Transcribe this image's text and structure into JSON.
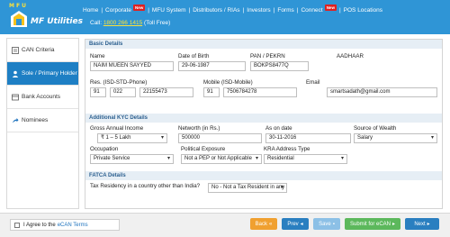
{
  "logo": {
    "letters": "MFU",
    "text": "MF Utilities"
  },
  "nav": {
    "items": [
      {
        "label": "Home",
        "badge": ""
      },
      {
        "label": "Corporate",
        "badge": "New"
      },
      {
        "label": "MFU System",
        "badge": ""
      },
      {
        "label": "Distributors / RIAs",
        "badge": ""
      },
      {
        "label": "Investors",
        "badge": ""
      },
      {
        "label": "Forms",
        "badge": ""
      },
      {
        "label": "Connect",
        "badge": "New"
      },
      {
        "label": "POS Locations",
        "badge": ""
      }
    ],
    "call_prefix": "Call: ",
    "phone": "1800 266 1415",
    "call_suffix": " (Toll Free)"
  },
  "sidebar": {
    "items": [
      {
        "label": "CAN Criteria",
        "icon": "checklist-icon"
      },
      {
        "label": "Sole / Primary Holder",
        "icon": "user-icon"
      },
      {
        "label": "Bank Accounts",
        "icon": "bank-icon"
      },
      {
        "label": "Nominees",
        "icon": "share-icon"
      }
    ]
  },
  "basic": {
    "heading": "Basic Details",
    "name_label": "Name",
    "name_value": "NAIM MUEEN SAYYED",
    "dob_label": "Date of Birth",
    "dob_value": "29-06-1987",
    "pan_label": "PAN / PEKRN",
    "pan_value": "BOKPS8477Q",
    "aadhaar_label": "AADHAAR",
    "aadhaar_value": "",
    "res_label": "Res. (ISD-STD-Phone)",
    "res_isd": "91",
    "res_std": "022",
    "res_phone": "22155473",
    "mobile_label": "Mobile (ISD-Mobile)",
    "mobile_isd": "91",
    "mobile_value": "7506784278",
    "email_label": "Email",
    "email_value": "smartsadath@gmail.com"
  },
  "kyc": {
    "heading": "Additional KYC Details",
    "income_label": "Gross Annual Income",
    "income_value": "₹ 1 – 5 Lakh",
    "networth_label": "Networth (in Rs.)",
    "networth_value": "500000",
    "ason_label": "As on date",
    "ason_value": "30-11-2016",
    "wealth_label": "Source of Wealth",
    "wealth_value": "Salary",
    "occupation_label": "Occupation",
    "occupation_value": "Private Service",
    "pep_label": "Political Exposure",
    "pep_value": "Not a PEP or Not Applicable",
    "kra_label": "KRA Address Type",
    "kra_value": "Residential"
  },
  "fatca": {
    "heading": "FATCA Details",
    "tax_label": "Tax Residency in a country other than India?",
    "tax_value": "No - Not a Tax Resident in any"
  },
  "footer": {
    "terms_prefix": "I Agree to the ",
    "terms_link": "eCAN Terms",
    "back": "Back",
    "prev": "Prev",
    "save": "Save",
    "submit": "Submit for eCAN",
    "next": "Next"
  },
  "colors": {
    "header": "#2f95d6",
    "sidebar_active": "#1e7fc4",
    "back_button": "#f0a030",
    "prev_button": "#2a7fc0",
    "save_button": "#8cc0e6",
    "submit_button": "#5cb85c",
    "next_button": "#2a7fc0"
  }
}
